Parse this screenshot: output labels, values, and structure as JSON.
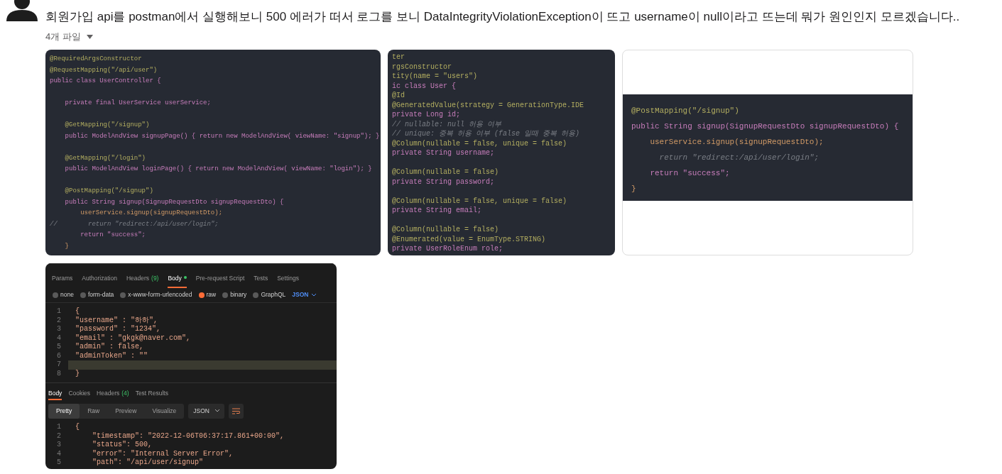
{
  "message": {
    "text": "회원가입 api를 postman에서 실행해보니 500 에러가 떠서 로그를 보니 DataIntegrityViolationException이 뜨고 username이 null이라고 뜨는데 뭐가 원인인지 모르겠습니다..",
    "files_label": "4개 파일"
  },
  "attachments": [
    {
      "kind": "code",
      "lines": [
        {
          "kind": "annotation",
          "text": "@RequiredArgsConstructor"
        },
        {
          "kind": "annotation",
          "text": "@RequestMapping(\"/api/user\")"
        },
        {
          "kind": "keyword",
          "text": "public class UserController {"
        },
        {
          "kind": "blank"
        },
        {
          "kind": "keyword",
          "text": "    private final UserService userService;"
        },
        {
          "kind": "blank"
        },
        {
          "kind": "annotation",
          "text": "    @GetMapping(\"/signup\")"
        },
        {
          "kind": "keyword",
          "text": "    public ModelAndView signupPage() { return new ModelAndView( viewName: \"signup\"); }"
        },
        {
          "kind": "blank"
        },
        {
          "kind": "annotation",
          "text": "    @GetMapping(\"/login\")"
        },
        {
          "kind": "keyword",
          "text": "    public ModelAndView loginPage() { return new ModelAndView( viewName: \"login\"); }"
        },
        {
          "kind": "blank"
        },
        {
          "kind": "annotation",
          "text": "    @PostMapping(\"/signup\")"
        },
        {
          "kind": "keyword",
          "text": "    public String signup(SignupRequestDto signupRequestDto) {"
        },
        {
          "kind": "code",
          "text": "        userService.signup(signupRequestDto);"
        },
        {
          "kind": "comment",
          "text": "//        return \"redirect:/api/user/login\";"
        },
        {
          "kind": "keyword",
          "text": "        return \"success\";"
        },
        {
          "kind": "code",
          "text": "    }"
        }
      ]
    },
    {
      "kind": "cropped_code",
      "lines": [
        {
          "kind": "annotation",
          "text": "ter"
        },
        {
          "kind": "annotation",
          "text": "rgsConstructor"
        },
        {
          "kind": "annotation",
          "text": "tity(name = \"users\")"
        },
        {
          "kind": "keyword",
          "text": "ic class User {"
        },
        {
          "kind": "annotation",
          "text": "@Id"
        },
        {
          "kind": "annotation",
          "text": "@GeneratedValue(strategy = GenerationType.IDE"
        },
        {
          "kind": "keyword",
          "text": "private Long id;"
        },
        {
          "kind": "comment",
          "text": "// nullable: null 허용 여부"
        },
        {
          "kind": "comment",
          "text": "// unique: 중복 허용 여부 (false 일때 중복 허용)"
        },
        {
          "kind": "annotation",
          "text": "@Column(nullable = false, unique = false)"
        },
        {
          "kind": "keyword",
          "text": "private String username;"
        },
        {
          "kind": "blank"
        },
        {
          "kind": "annotation",
          "text": "@Column(nullable = false)"
        },
        {
          "kind": "keyword",
          "text": "private String password;"
        },
        {
          "kind": "blank"
        },
        {
          "kind": "annotation",
          "text": "@Column(nullable = false, unique = false)"
        },
        {
          "kind": "keyword",
          "text": "private String email;"
        },
        {
          "kind": "blank"
        },
        {
          "kind": "annotation",
          "text": "@Column(nullable = false)"
        },
        {
          "kind": "annotation",
          "text": "@Enumerated(value = EnumType.STRING)"
        },
        {
          "kind": "keyword",
          "text": "private UserRoleEnum role;"
        }
      ]
    },
    {
      "kind": "snippet",
      "lines": [
        {
          "kind": "annotation",
          "text": "@PostMapping(\"/signup\")"
        },
        {
          "kind": "keyword",
          "text": "public String signup(SignupRequestDto signupRequestDto) {"
        },
        {
          "kind": "code",
          "text": "    userService.signup(signupRequestDto);"
        },
        {
          "kind": "comment",
          "text": "      return \"redirect:/api/user/login\";"
        },
        {
          "kind": "keyword",
          "text": "    return \"success\";"
        },
        {
          "kind": "code",
          "text": "}"
        }
      ]
    },
    {
      "kind": "postman",
      "request_tabs": [
        {
          "label": "Params",
          "selected": false
        },
        {
          "label": "Authorization",
          "selected": false
        },
        {
          "label": "Headers",
          "count": "(9)",
          "selected": false
        },
        {
          "label": "Body",
          "dot": true,
          "selected": true
        },
        {
          "label": "Pre-request Script",
          "selected": false
        },
        {
          "label": "Tests",
          "selected": false
        },
        {
          "label": "Settings",
          "selected": false
        }
      ],
      "body_types": [
        {
          "label": "none",
          "selected": false
        },
        {
          "label": "form-data",
          "selected": false
        },
        {
          "label": "x-www-form-urlencoded",
          "selected": false
        },
        {
          "label": "raw",
          "selected": true
        },
        {
          "label": "binary",
          "selected": false
        },
        {
          "label": "GraphQL",
          "selected": false
        }
      ],
      "format": "JSON",
      "request_lines": [
        {
          "number": "1",
          "text": "{"
        },
        {
          "number": "2",
          "text": "\"username\" : \"하하\","
        },
        {
          "number": "3",
          "text": "\"password\" : \"1234\","
        },
        {
          "number": "4",
          "text": "\"email\" : \"gkgk@naver.com\","
        },
        {
          "number": "5",
          "text": "\"admin\" : false,"
        },
        {
          "number": "6",
          "text": "\"adminToken\" : \"\""
        },
        {
          "number": "7",
          "current": true
        },
        {
          "number": "8",
          "text": "}"
        }
      ],
      "response_tabs": [
        {
          "label": "Body",
          "selected": true
        },
        {
          "label": "Cookies",
          "selected": false
        },
        {
          "label": "Headers",
          "count": "(4)",
          "selected": false
        },
        {
          "label": "Test Results",
          "selected": false
        }
      ],
      "view_modes": [
        {
          "label": "Pretty",
          "selected": true
        },
        {
          "label": "Raw",
          "selected": false
        },
        {
          "label": "Preview",
          "selected": false
        },
        {
          "label": "Visualize",
          "selected": false
        }
      ],
      "response_format": "JSON",
      "response_lines": [
        {
          "number": "1",
          "text": "{"
        },
        {
          "number": "2",
          "text": "    \"timestamp\": \"2022-12-06T06:37:17.861+00:00\","
        },
        {
          "number": "3",
          "text": "    \"status\": 500,"
        },
        {
          "number": "4",
          "text": "    \"error\": \"Internal Server Error\","
        },
        {
          "number": "5",
          "text": "    \"path\": \"/api/user/signup\""
        }
      ]
    }
  ]
}
